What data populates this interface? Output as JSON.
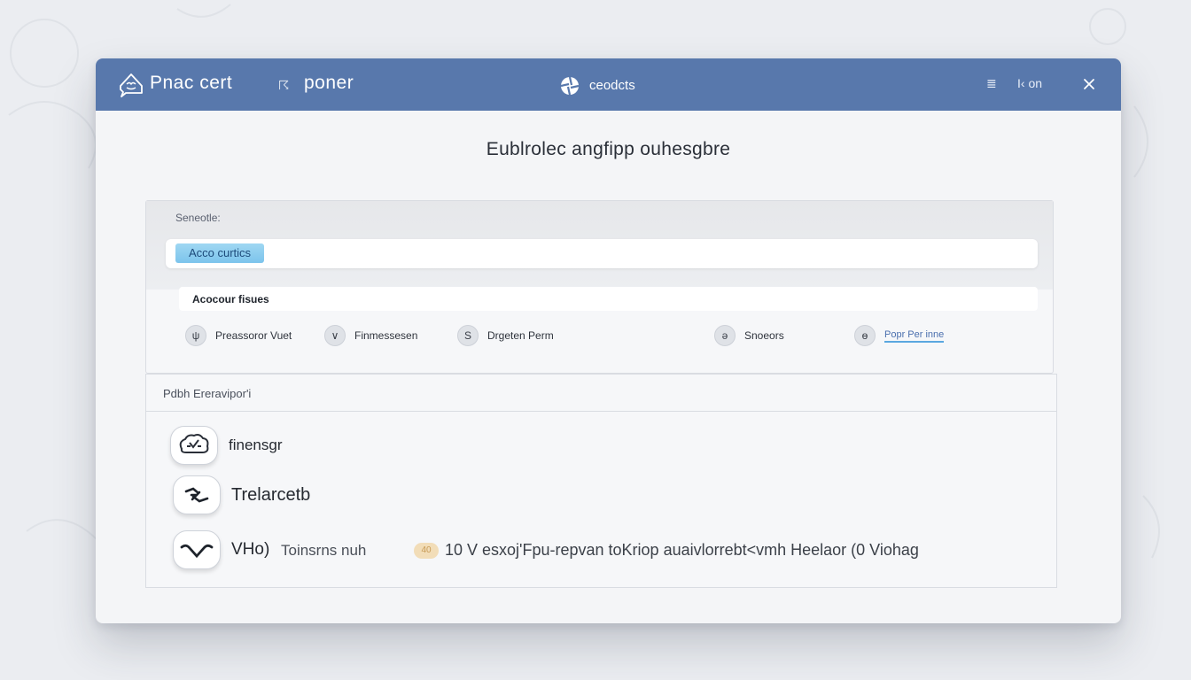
{
  "window": {
    "app_name": "Pnac cert",
    "sub_label": "poner",
    "center_label": "ceodcts",
    "controls": [
      "≣",
      "I‹ on"
    ],
    "icons": {
      "logo": "brain-chat-icon",
      "center": "aperture-icon",
      "close": "close-icon"
    }
  },
  "heading": "Eublrolec angfipp ouhesgbre",
  "top_panel": {
    "section_label": "Seneotle:",
    "search_chip": "Acco curtics",
    "account_label": "Acocour fisues",
    "options": [
      {
        "icon": "ψ",
        "label": "Preassoror Vuet"
      },
      {
        "icon": "∨",
        "label": "Finmessesen"
      },
      {
        "icon": "S",
        "label": "Drgeten Perm"
      },
      {
        "icon": "ə",
        "label": "Snoeors"
      },
      {
        "icon": "ɵ",
        "label": "Popr Per inne"
      }
    ]
  },
  "bottom_panel": {
    "title": "Pdbh Ereravipor'i",
    "items": [
      {
        "icon": "cloud-connect-icon",
        "label": "finensgr"
      },
      {
        "icon": "handshake-icon",
        "label": "Trelarcetb"
      },
      {
        "icon": "heart-signal-icon",
        "label": "VHo)"
      }
    ],
    "extra_label": "Toinsrns nuh",
    "badge": "40",
    "long_text": "10 V esxoj'Fpu-repvan toKriop auaivlorrebt<vmh Heelaor (0 Viohag"
  },
  "colors": {
    "titlebar": "#5878ac",
    "chip": "#8ccdf0",
    "badge": "#f2ddb8",
    "link_underline": "#5aa7e0"
  }
}
